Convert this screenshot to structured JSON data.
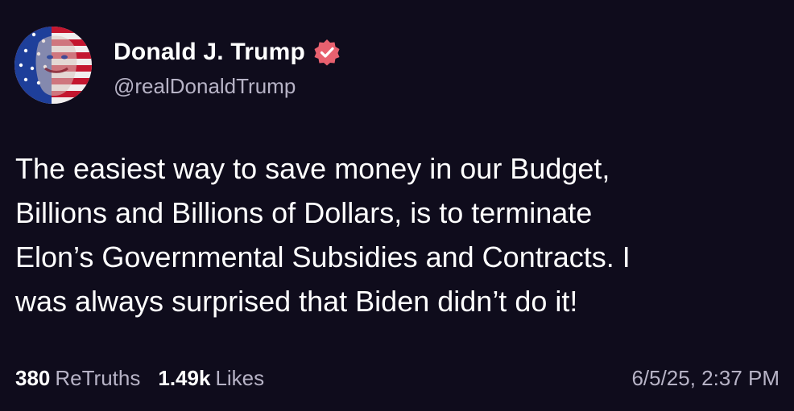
{
  "post": {
    "author": {
      "display_name": "Donald J. Trump",
      "handle": "@realDonaldTrump",
      "verified_icon": "verified-badge-icon",
      "avatar": "avatar-flag-portrait"
    },
    "text": "The easiest way to save money in our Budget,\nBillions and Billions of Dollars, is to terminate\nElon’s Governmental Subsidies and Contracts. I\nwas always surprised that Biden didn’t do it!",
    "stats": {
      "retruths_count": "380",
      "retruths_label": "ReTruths",
      "likes_count": "1.49k",
      "likes_label": "Likes"
    },
    "timestamp": "6/5/25, 2:37 PM"
  },
  "colors": {
    "background": "#0f0c1c",
    "text_primary": "#ffffff",
    "text_secondary": "#b7b3c6",
    "verified_badge": "#e8616f"
  }
}
